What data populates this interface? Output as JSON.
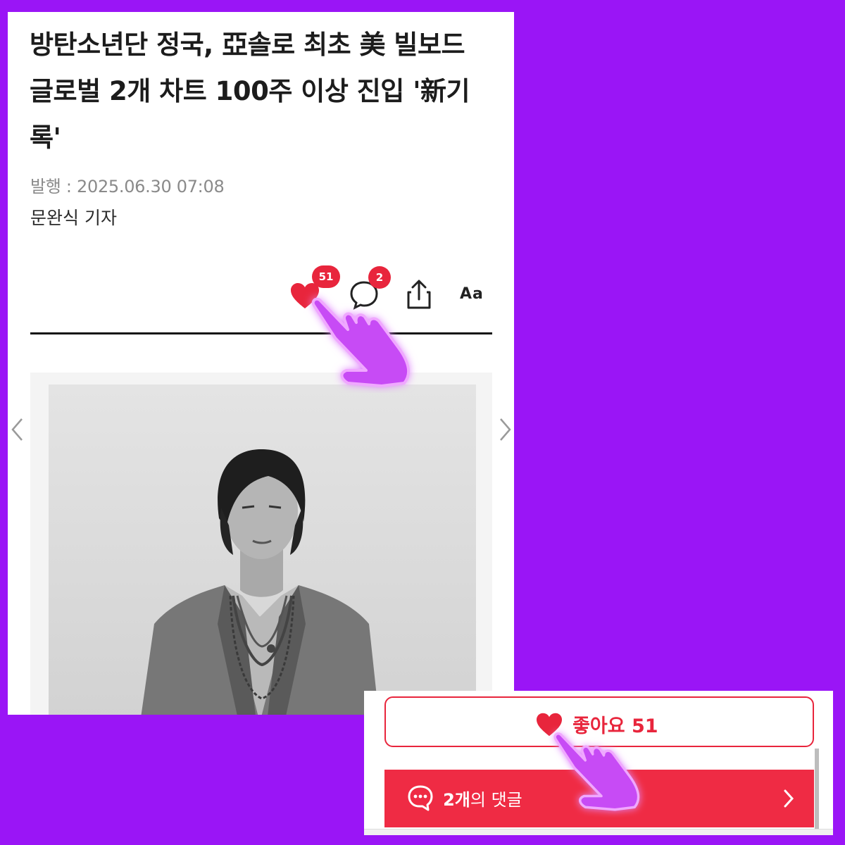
{
  "article": {
    "headline_lines": [
      "방탄소년단 정국, 亞솔로 최초 美 빌보드",
      "글로벌 2개 차트 100주 이상 진입 '新기",
      "록'"
    ],
    "published": "발행 : 2025.06.30 07:08",
    "author": "문완식 기자"
  },
  "actions": {
    "like_icon": "heart-icon",
    "like_count": "51",
    "comment_icon": "comment-bubble-icon",
    "comment_count": "2",
    "share_icon": "share-icon",
    "font_size_label": "Aa"
  },
  "gallery": {
    "photo_description_icon": "photo",
    "prev_icon": "chevron-left-icon",
    "next_icon": "chevron-right-icon"
  },
  "inset": {
    "like_button_label": "좋아요 51",
    "comments_count_text": "2개",
    "comments_suffix_text": "의 댓글",
    "comments_icon": "speech-bubble-icon",
    "comments_arrow_icon": "chevron-right-icon"
  },
  "colors": {
    "background": "#9a15f6",
    "accent": "#e8253c",
    "comment_bar": "#ef2b44",
    "pointer": "#c74bf5"
  }
}
